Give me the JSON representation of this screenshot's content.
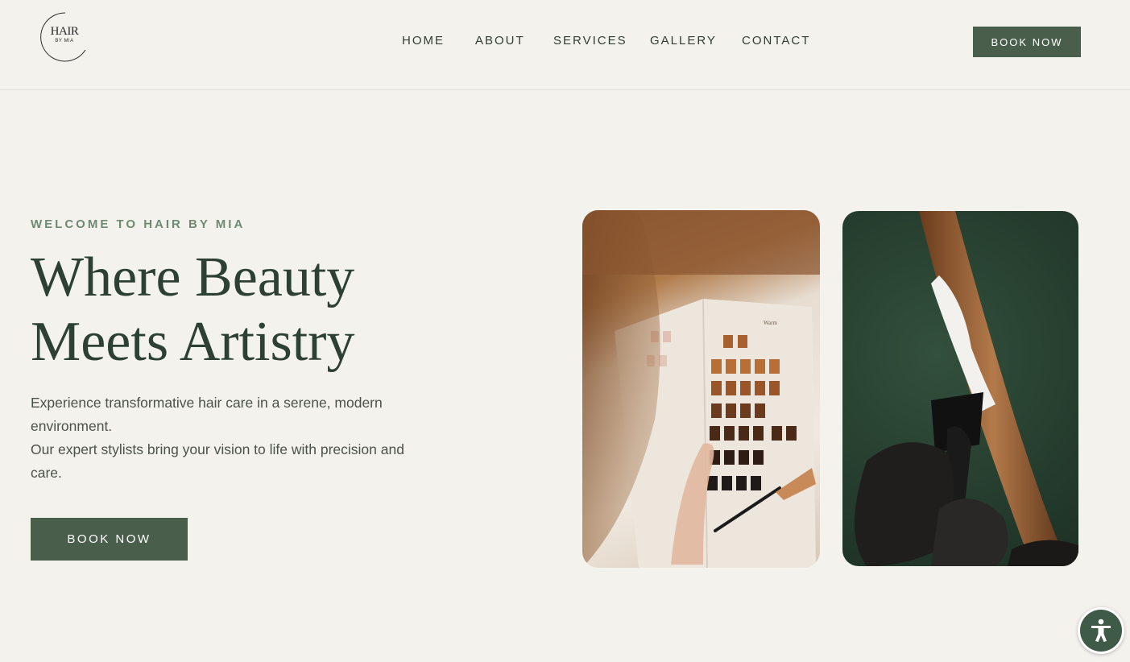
{
  "brand": {
    "logo_main": "HAIR",
    "logo_sub": "BY MIA"
  },
  "nav": {
    "items": [
      {
        "label": "HOME"
      },
      {
        "label": "ABOUT"
      },
      {
        "label": "SERVICES"
      },
      {
        "label": "GALLERY"
      },
      {
        "label": "CONTACT"
      }
    ],
    "cta_label": "BOOK NOW"
  },
  "hero": {
    "eyebrow": "WELCOME TO HAIR BY MIA",
    "headline_line1": "Where Beauty",
    "headline_line2": "Meets Artistry",
    "body_line1": "Experience transformative hair care in a serene, modern environment.",
    "body_line2": "Our expert stylists bring your vision to life with precision and care.",
    "cta_label": "BOOK NOW"
  },
  "colors": {
    "background": "#f4f2ed",
    "accent": "#4a5e4c",
    "heading": "#2c4034",
    "eyebrow": "#6f8a73"
  },
  "icons": {
    "accessibility": "accessibility-icon"
  }
}
